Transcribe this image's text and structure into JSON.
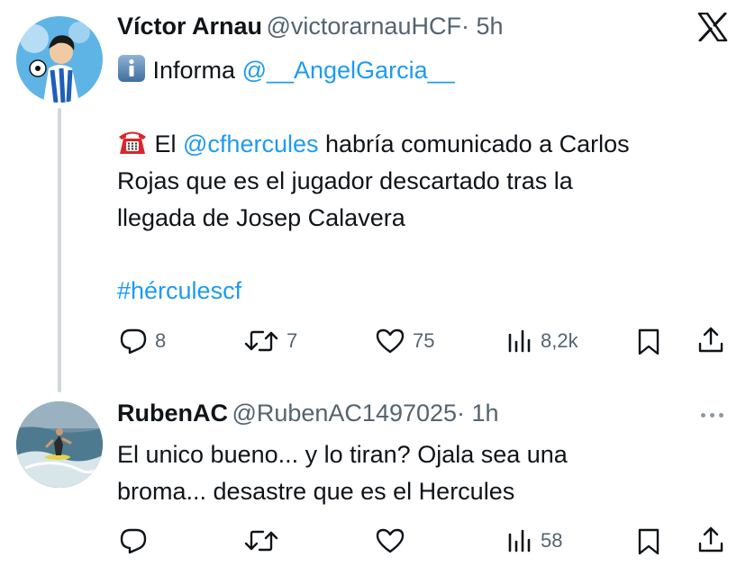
{
  "tweet1": {
    "name": "Víctor Arnau",
    "handle": "@victorarnauHCF",
    "time": "· 5h",
    "info_prefix": "Informa ",
    "info_mention": "@__AngelGarcia__",
    "body_line1_prefix": " El ",
    "body_mention": "@cfhercules",
    "body_line1_suffix": " habría comunicado a Carlos",
    "body_line2": "Rojas que es el jugador descartado tras la",
    "body_line3": "llegada de Josep Calavera",
    "hashtag": "#hérculescf",
    "replies": "8",
    "retweets": "7",
    "likes": "75",
    "views": "8,2k",
    "icons": {
      "info": "info-emoji-icon",
      "phone": "telephone-emoji-icon",
      "logo": "x-logo-icon"
    }
  },
  "tweet2": {
    "name": "RubenAC",
    "handle": "@RubenAC1497025",
    "time": "· 1h",
    "body_line1": "El unico bueno... y lo tiran? Ojala sea una",
    "body_line2": "broma... desastre que es el Hercules",
    "views": "58"
  },
  "colors": {
    "link": "#1d9bf0",
    "secondary_text": "#536471",
    "thread_line": "#cfd9de"
  }
}
